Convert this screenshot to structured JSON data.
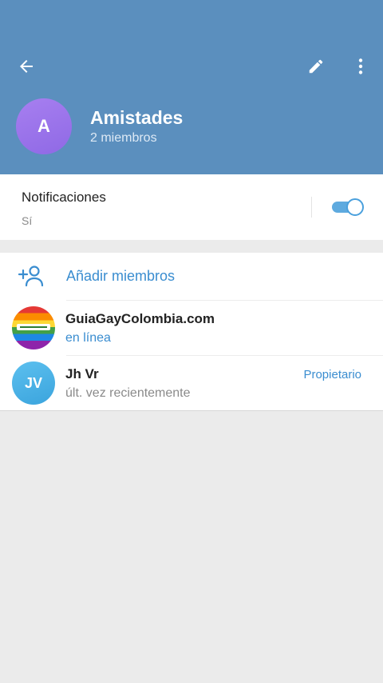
{
  "header": {
    "back_icon": "arrow-left-icon",
    "edit_icon": "pencil-icon",
    "more_icon": "more-vertical-icon",
    "avatar_letter": "A",
    "title": "Amistades",
    "subtitle": "2 miembros",
    "color": "#5b8fbe"
  },
  "notifications": {
    "label": "Notificaciones",
    "value": "Sí",
    "enabled": true
  },
  "members": {
    "add_label": "Añadir miembros",
    "add_icon": "add-user-icon",
    "list": [
      {
        "name": "GuiaGayColombia.com",
        "status": "en línea",
        "role": ""
      },
      {
        "name": "Jh Vr",
        "initials": "JV",
        "status": "últ. vez recientemente",
        "role": "Propietario"
      }
    ]
  },
  "accent_color": "#3a8dd0"
}
